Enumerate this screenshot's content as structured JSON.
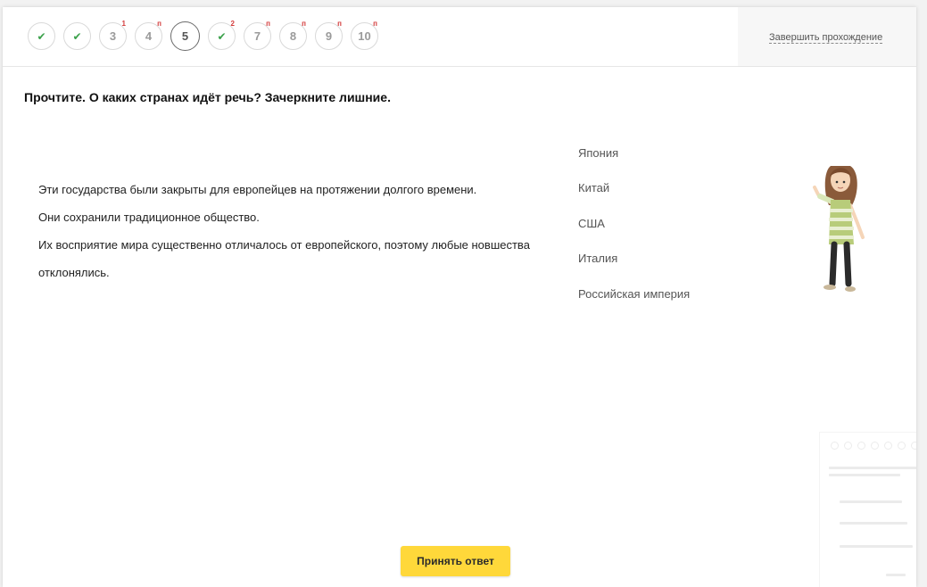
{
  "navigation": {
    "steps": [
      {
        "label": "",
        "status": "done",
        "badge": ""
      },
      {
        "label": "",
        "status": "done",
        "badge": ""
      },
      {
        "label": "3",
        "status": "pending",
        "badge": "1"
      },
      {
        "label": "4",
        "status": "pending",
        "badge": "п"
      },
      {
        "label": "5",
        "status": "current",
        "badge": ""
      },
      {
        "label": "",
        "status": "done",
        "badge": "2"
      },
      {
        "label": "7",
        "status": "pending",
        "badge": "п"
      },
      {
        "label": "8",
        "status": "pending",
        "badge": "п"
      },
      {
        "label": "9",
        "status": "pending",
        "badge": "п"
      },
      {
        "label": "10",
        "status": "pending",
        "badge": "п"
      }
    ],
    "finish_label": "Завершить прохождение"
  },
  "question": {
    "title": "Прочтите. О каких странах идёт речь? Зачеркните лишние."
  },
  "passage": {
    "lines": [
      "Эти  государства были закрыты для европейцев на протяжении долгого времени.",
      "Они  сохранили традиционное общество.",
      "Их восприятие мира существенно отличалось от европейского, поэтому любые новшества отклонялись."
    ]
  },
  "options": [
    "Япония",
    "Китай",
    "США",
    "Италия",
    "Российская империя"
  ],
  "submit": {
    "label": "Принять ответ"
  },
  "colors": {
    "accent_button": "#ffd83a",
    "check": "#3aa14a",
    "badge": "#d33b3b"
  },
  "icons": {
    "done_step": "checkmark-icon",
    "mascot": "girl-mascot-illustration"
  }
}
